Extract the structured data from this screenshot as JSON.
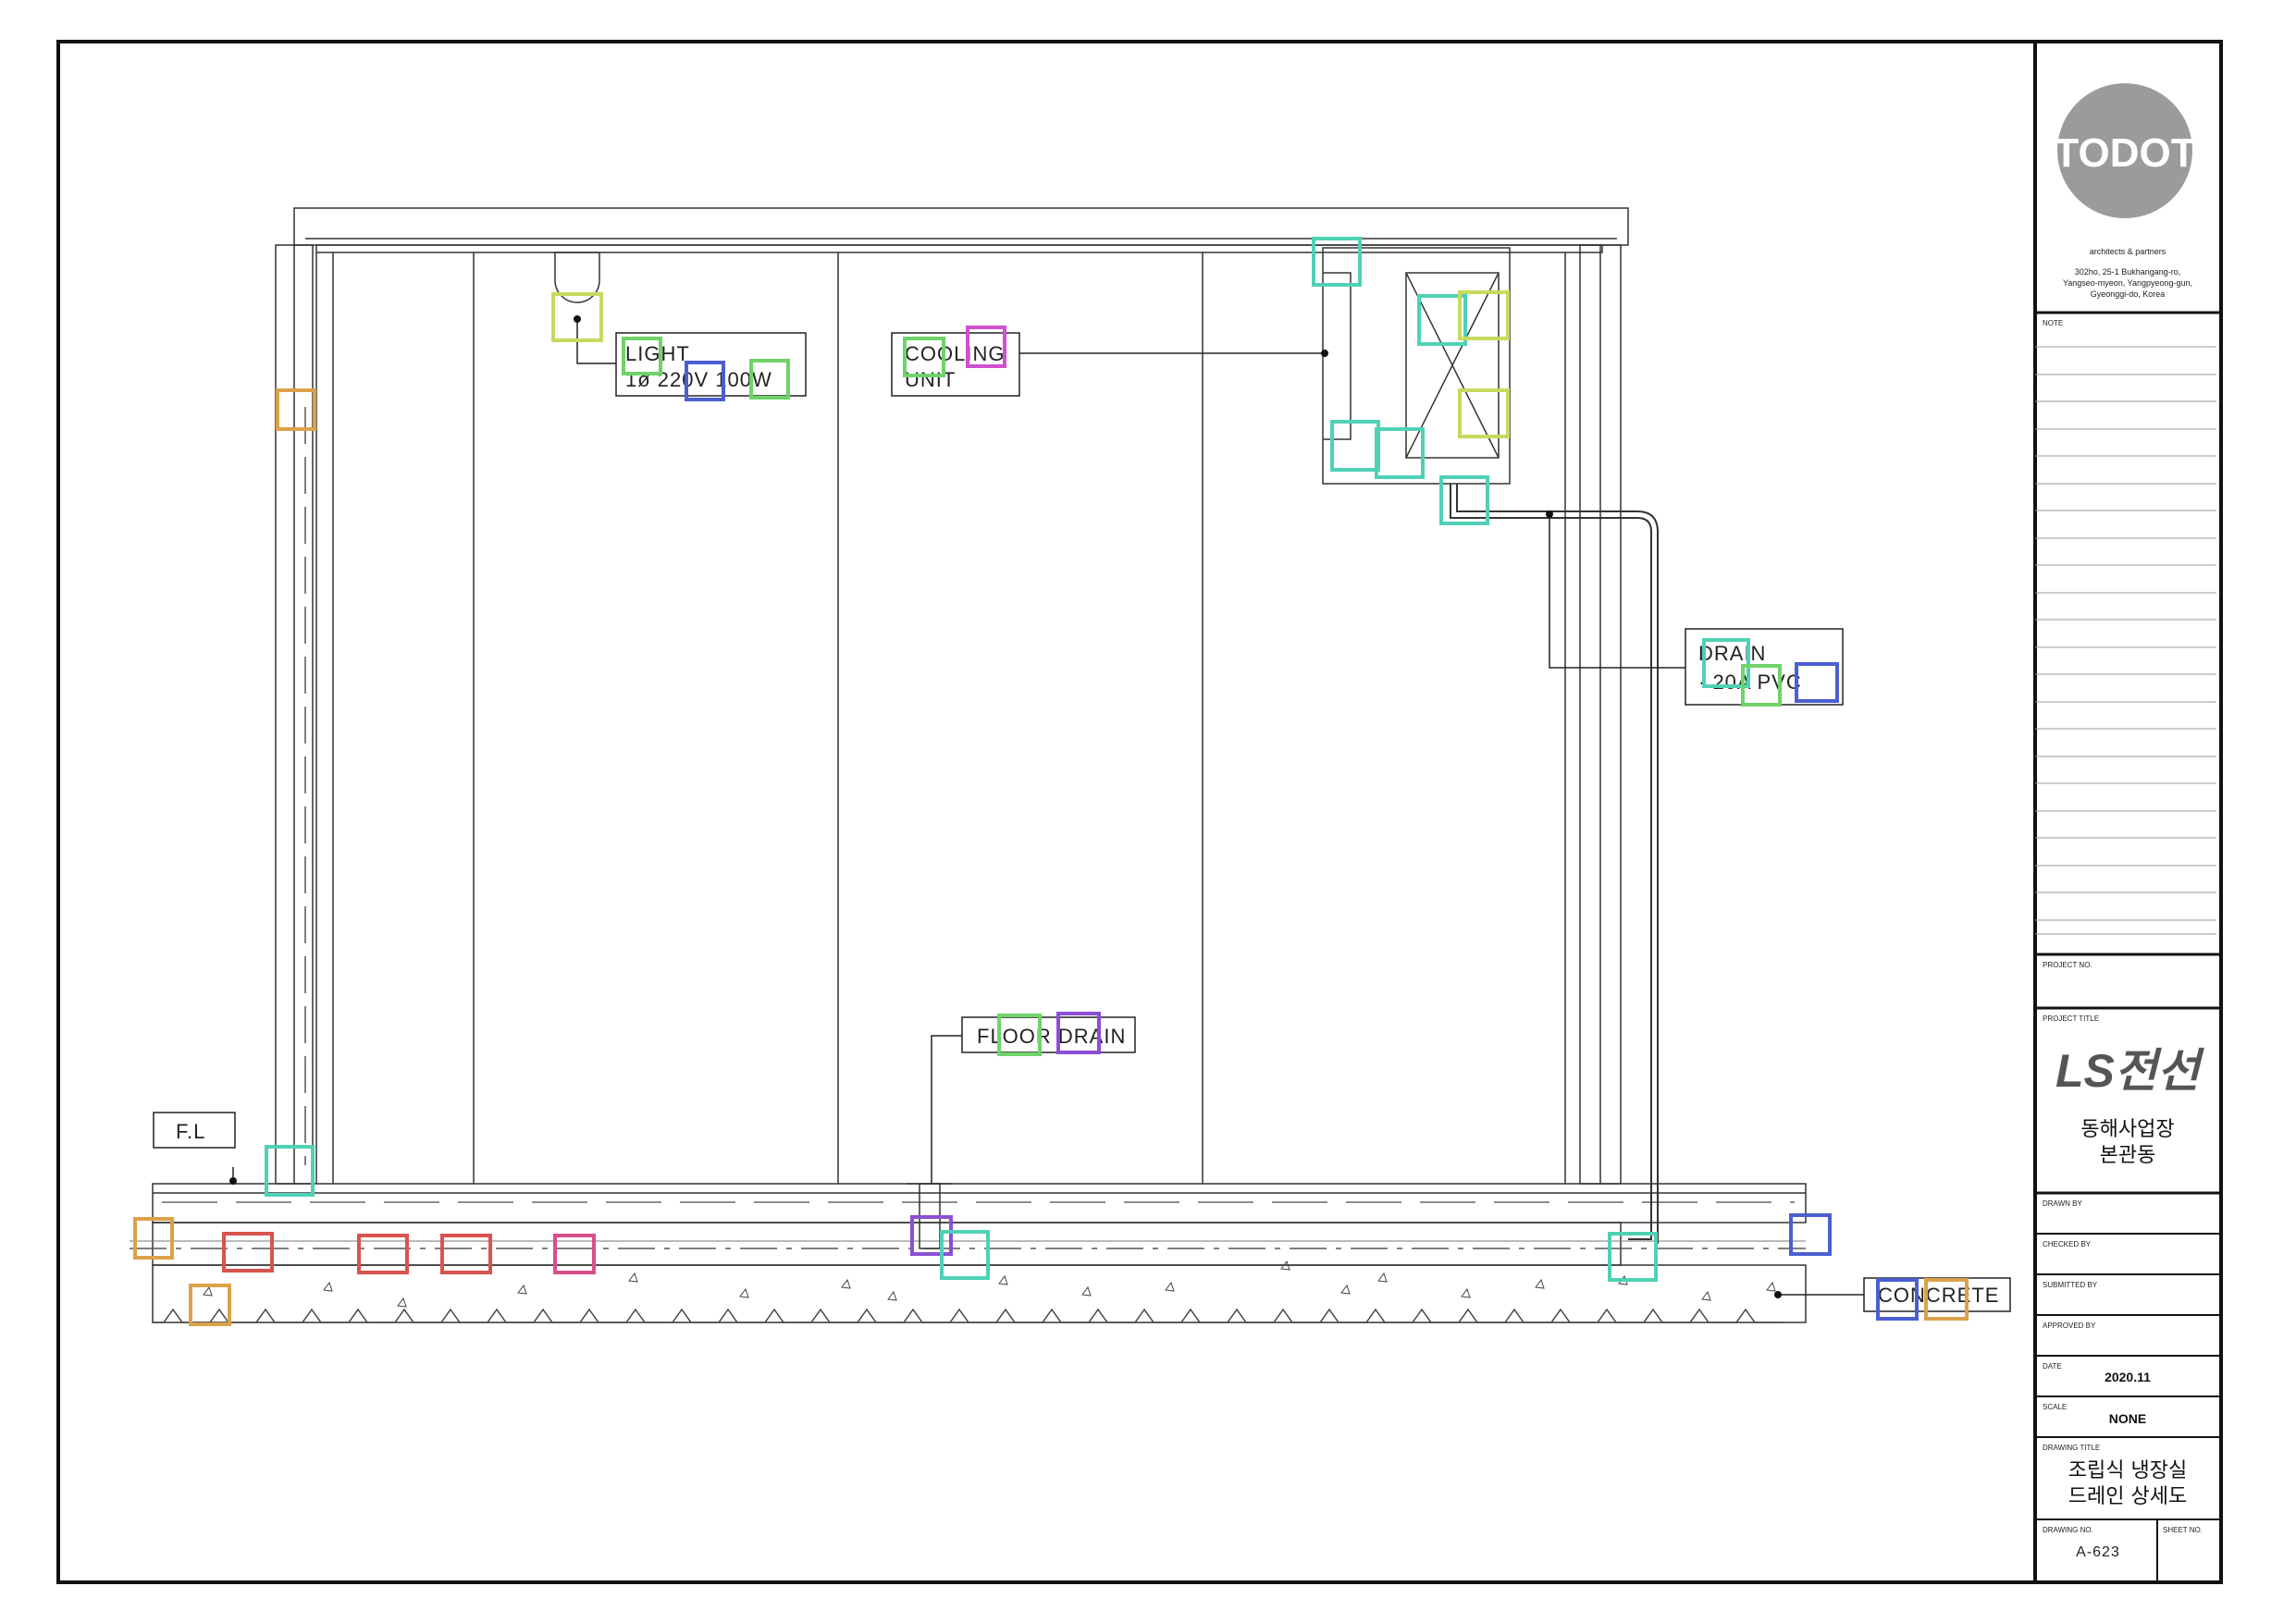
{
  "labels": {
    "light": {
      "line1": "LIGHT",
      "line2": "1ø 220V 100W"
    },
    "cooling_unit": {
      "line1": "COOLING",
      "line2": "UNIT"
    },
    "drain": {
      "line1": "DRAIN",
      "line2": "· 20A PVC"
    },
    "floor_drain": "FLOOR DRAIN",
    "fl": "F.L",
    "concrete": "CONCRETE"
  },
  "title_block": {
    "logo_text": "TODOT",
    "firm_tagline": "architects & partners",
    "address": [
      "302ho, 25-1 Bukhangang-ro,",
      "Yangseo-myeon, Yangpyeong-gun,",
      "Gyeonggi-do, Korea"
    ],
    "note_caption": "NOTE",
    "project_no_caption": "PROJECT NO.",
    "project_title_caption": "PROJECT TITLE",
    "client_logo_text": "LS전선",
    "project_title": [
      "동해사업장",
      "본관동"
    ],
    "drawn_by_caption": "DRAWN BY",
    "checked_by_caption": "CHECKED BY",
    "submitted_by_caption": "SUBMITTED BY",
    "approved_by_caption": "APPROVED BY",
    "date_caption": "DATE",
    "date": "2020.11",
    "scale_caption": "SCALE",
    "scale": "NONE",
    "drawing_title_caption": "DRAWING TITLE",
    "drawing_title": [
      "조립식 냉장실",
      "드레인 상세도"
    ],
    "drawing_no_caption": "DRAWING NO.",
    "sheet_no_caption": "SHEET NO.",
    "drawing_no": "A-623"
  },
  "marker_colors": {
    "teal": "#4fd1b5",
    "green": "#6fd36a",
    "yellow_green": "#c6db5e",
    "blue": "#4b5fd1",
    "purple": "#8a4fd6",
    "magenta": "#d14fd1",
    "orange": "#dba24a",
    "red": "#d9534f",
    "pink": "#d94f8a"
  }
}
